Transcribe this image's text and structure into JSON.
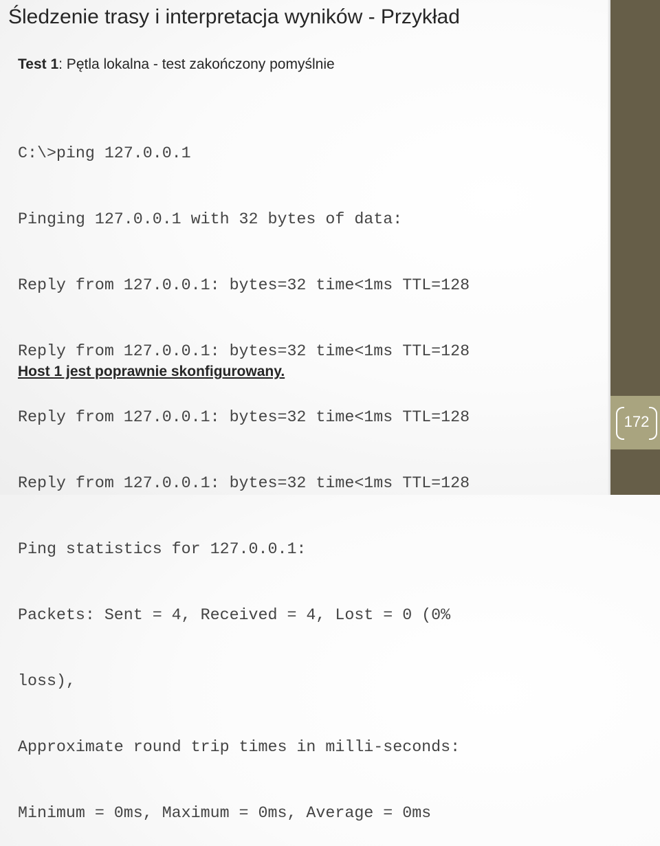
{
  "slide": {
    "title": "Śledzenie trasy i interpretacja wyników - Przykład",
    "test_label": "Test 1",
    "test_desc": ": Pętla lokalna - test zakończony pomyślnie",
    "console_lines": [
      "C:\\>ping 127.0.0.1",
      "Pinging 127.0.0.1 with 32 bytes of data:",
      "Reply from 127.0.0.1: bytes=32 time<1ms TTL=128",
      "Reply from 127.0.0.1: bytes=32 time<1ms TTL=128",
      "Reply from 127.0.0.1: bytes=32 time<1ms TTL=128",
      "Reply from 127.0.0.1: bytes=32 time<1ms TTL=128",
      "Ping statistics for 127.0.0.1:",
      "Packets: Sent = 4, Received = 4, Lost = 0 (0%",
      "loss),",
      "Approximate round trip times in milli-seconds:",
      "Minimum = 0ms, Maximum = 0ms, Average = 0ms"
    ],
    "conclusion": "Host 1 jest poprawnie skonfigurowany.",
    "page_number": "172"
  },
  "colors": {
    "sidebar": "#665e48",
    "page_band": "#a9a47f"
  }
}
